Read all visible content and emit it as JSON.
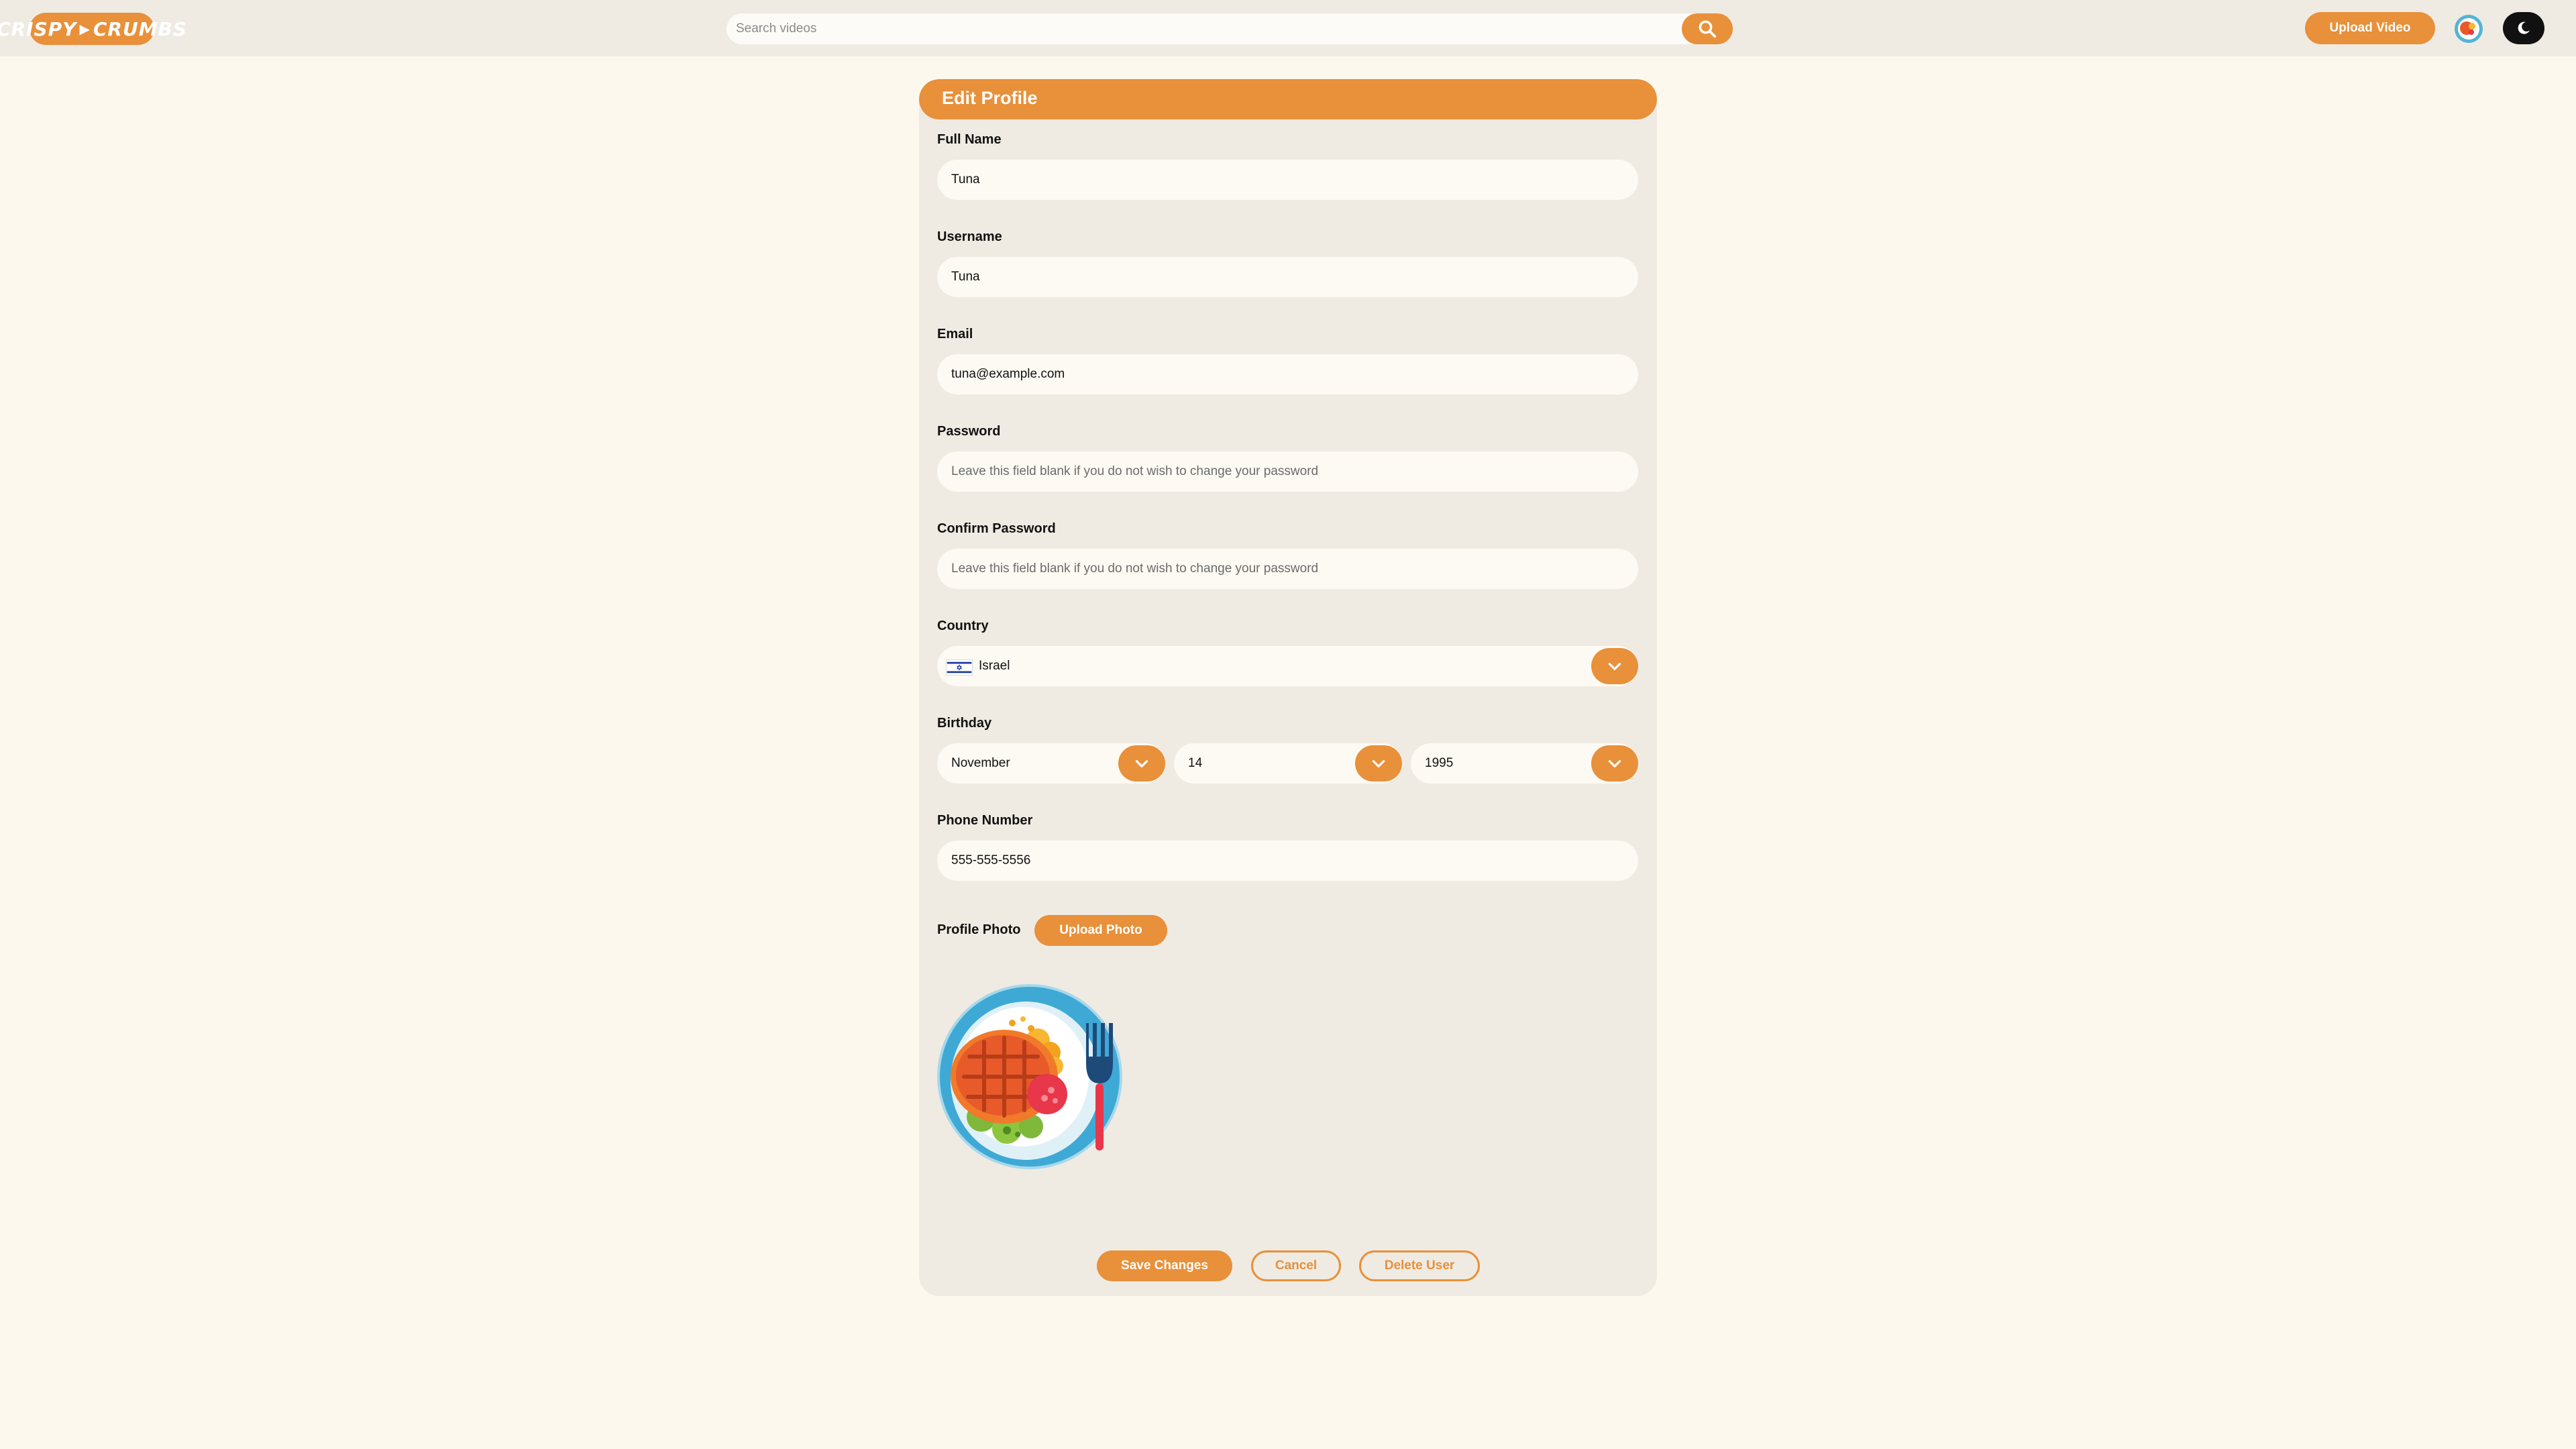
{
  "header": {
    "logo_text_left": "CRISPY",
    "logo_text_right": "CRUMBS",
    "search_placeholder": "Search videos",
    "upload_video_label": "Upload Video"
  },
  "form": {
    "title": "Edit Profile",
    "full_name": {
      "label": "Full Name",
      "value": "Tuna"
    },
    "username": {
      "label": "Username",
      "value": "Tuna"
    },
    "email": {
      "label": "Email",
      "value": "tuna@example.com"
    },
    "password": {
      "label": "Password",
      "placeholder": "Leave this field blank if you do not wish to change your password"
    },
    "confirm_password": {
      "label": "Confirm Password",
      "placeholder": "Leave this field blank if you do not wish to change your password"
    },
    "country": {
      "label": "Country",
      "value": "Israel",
      "flag_icon": "israel-flag-icon"
    },
    "birthday": {
      "label": "Birthday",
      "month": "November",
      "day": "14",
      "year": "1995"
    },
    "phone": {
      "label": "Phone Number",
      "value": "555-555-5556"
    },
    "profile_photo": {
      "label": "Profile Photo",
      "upload_label": "Upload Photo",
      "image_icon": "food-plate-icon"
    }
  },
  "actions": {
    "save_label": "Save Changes",
    "cancel_label": "Cancel",
    "delete_label": "Delete User"
  },
  "colors": {
    "accent": "#e8903a",
    "page_bg": "#fdf8ee",
    "card_bg": "#efebe3",
    "field_bg": "#fdfaf3"
  }
}
